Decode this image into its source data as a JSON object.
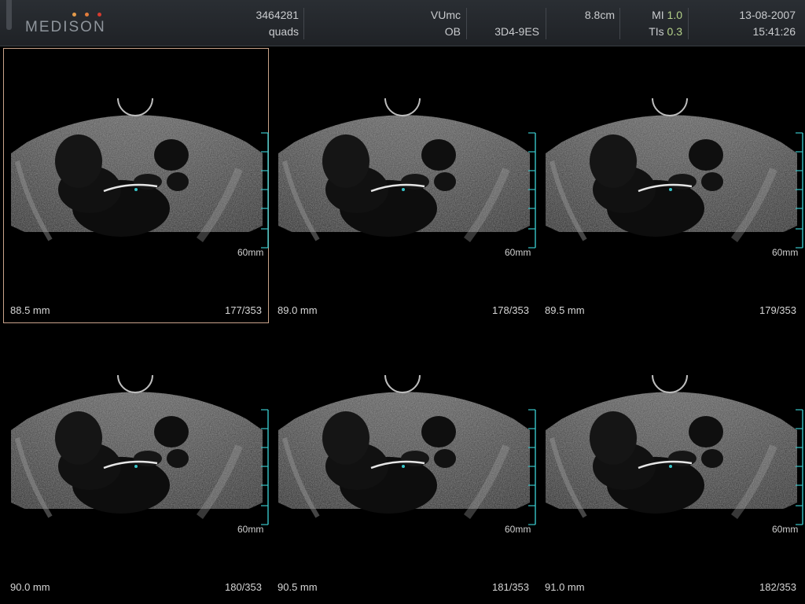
{
  "header": {
    "brand": "MEDISON",
    "brand_dot_colors": [
      "#e39a4a",
      "#e27d3c",
      "#d63b2f"
    ],
    "patient_id": "3464281",
    "mode": "quads",
    "institution": "VUmc",
    "application": "OB",
    "probe": "3D4-9ES",
    "depth": "8.8cm",
    "mi_label": "MI",
    "mi_value": "1.0",
    "tis_label": "TIs",
    "tis_value": "0.3",
    "date": "13-08-2007",
    "time": "15:41:26"
  },
  "colors": {
    "background": "#000000",
    "scale_marker": "#38c4c8",
    "selected_frame": "#c9a38a",
    "index_highlight": "#b5d28a"
  },
  "panels": [
    {
      "position": "88.5 mm",
      "slice": "177/353",
      "depth_scale": "60mm",
      "selected": true
    },
    {
      "position": "89.0 mm",
      "slice": "178/353",
      "depth_scale": "60mm",
      "selected": false
    },
    {
      "position": "89.5 mm",
      "slice": "179/353",
      "depth_scale": "60mm",
      "selected": false
    },
    {
      "position": "90.0 mm",
      "slice": "180/353",
      "depth_scale": "60mm",
      "selected": false
    },
    {
      "position": "90.5 mm",
      "slice": "181/353",
      "depth_scale": "60mm",
      "selected": false
    },
    {
      "position": "91.0 mm",
      "slice": "182/353",
      "depth_scale": "60mm",
      "selected": false
    }
  ]
}
